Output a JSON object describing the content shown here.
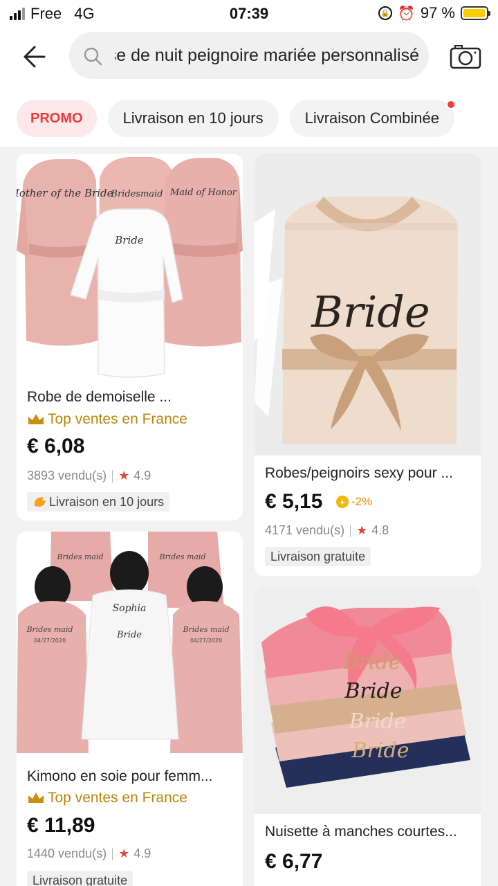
{
  "status": {
    "carrier": "Free",
    "network": "4G",
    "time": "07:39",
    "battery": "97 %",
    "battery_level": 0.97
  },
  "search": {
    "query": "chemise de nuit peignoire mariée personnalisé",
    "shown_text": "ıoire mariée personnalisé"
  },
  "filters": [
    {
      "label": "PROMO"
    },
    {
      "label": "Livraison en 10 jours"
    },
    {
      "label": "Livraison Combinée",
      "has_dot": true
    }
  ],
  "products": [
    {
      "title": "Robe de demoiselle ...",
      "badge": "Top ventes en France",
      "price": "€ 6,08",
      "sold": "3893 vendu(s)",
      "rating": "4.9",
      "tag": "Livraison en 10 jours",
      "images": [
        "Mother of the Bride",
        "Bridesmaid",
        "Maid of Honor",
        "Bride"
      ]
    },
    {
      "title": "Robes/peignoirs sexy pour ...",
      "price": "€ 5,15",
      "discount": "-2%",
      "sold": "4171 vendu(s)",
      "rating": "4.8",
      "tag": "Livraison gratuite",
      "images": [
        "Bride"
      ]
    },
    {
      "title": "Kimono en soie pour femm...",
      "badge": "Top ventes en France",
      "price": "€ 11,89",
      "sold": "1440 vendu(s)",
      "rating": "4.9",
      "tag": "Livraison gratuite",
      "images": [
        "Brides maid",
        "Sophia",
        "Bride",
        "04/27/2020"
      ]
    },
    {
      "title": "Nuisette à manches courtes...",
      "price": "€ 6,77",
      "images": [
        "Bride"
      ]
    }
  ],
  "colors": {
    "promo": "#e83c3c",
    "badge": "#b8860b",
    "star": "#e8453c",
    "coin": "#f5b800"
  }
}
